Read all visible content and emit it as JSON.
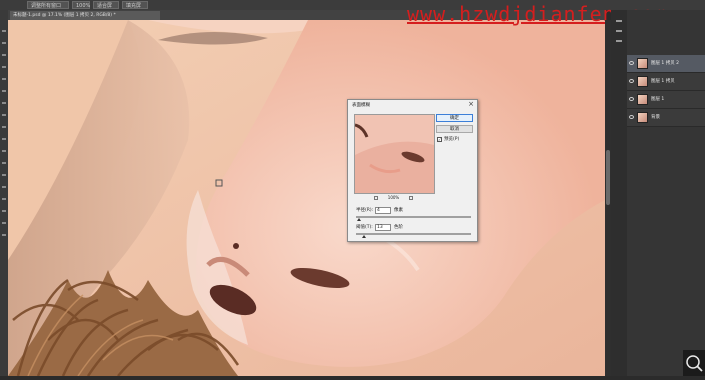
{
  "options_bar": {
    "buttons": [
      "调整所有窗口",
      "100%",
      "适合屏幕",
      "填充屏幕"
    ]
  },
  "document_tab": {
    "label": "未标题-1.psd @ 17.1% (图层 1 拷贝 2, RGB/8) *"
  },
  "watermark": {
    "text": "www.hzwdjdianfen.com"
  },
  "dialog": {
    "title": "表面模糊",
    "close": "×",
    "ok_label": "确定",
    "cancel_label": "取消",
    "preview_label": "预览(P)",
    "preview_checked": true,
    "zoom_level": "100%",
    "zoom_out": "−",
    "zoom_in": "+",
    "radius_label": "半径(R):",
    "radius_value": "4",
    "radius_unit": "像素",
    "threshold_label": "阈值(T):",
    "threshold_value": "13",
    "threshold_unit": "色阶"
  },
  "layers": [
    {
      "name": "图层 1 拷贝 2",
      "selected": true
    },
    {
      "name": "图层 1 拷贝",
      "selected": false
    },
    {
      "name": "图层 1",
      "selected": false
    },
    {
      "name": "背景",
      "selected": false
    }
  ],
  "colors": {
    "watermark": "#d51e1e",
    "skin": "#efc3a6",
    "dialog_bg": "#f0f0f0",
    "ui_dark": "#353535"
  },
  "icons": [
    "eye-icon",
    "zoom-magnifier-icon",
    "close-icon"
  ]
}
